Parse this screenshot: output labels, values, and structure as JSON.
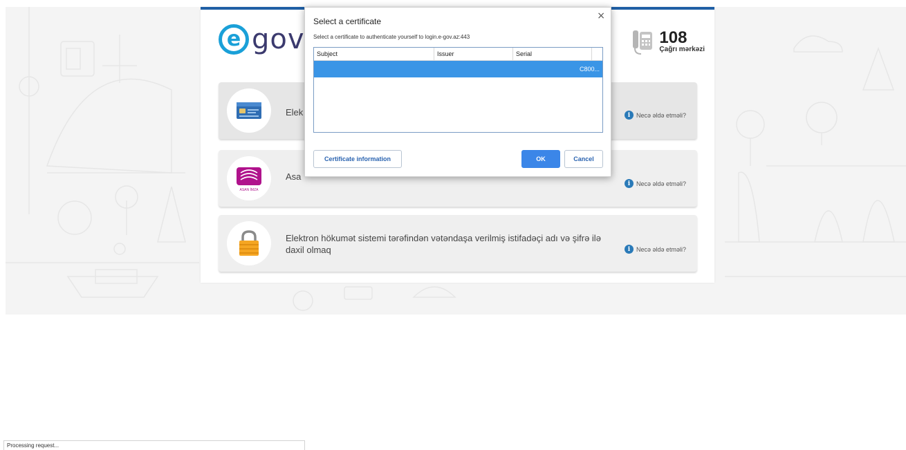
{
  "header": {
    "logo_symbol": "e",
    "logo_text": "gov",
    "call_number": "108",
    "call_label": "Çağrı mərkəzi"
  },
  "options": [
    {
      "text": "Elek",
      "help": "Necə əldə etməli?",
      "icon": "id-card-icon"
    },
    {
      "text": "Asa",
      "help": "Necə əldə etməli?",
      "icon": "asan-imza-icon",
      "icon_caption": "ASAN İMZA"
    },
    {
      "text": "Elektron hökumət sistemi tərəfindən vətəndaşa verilmiş istifadəçi adı və şifrə ilə daxil olmaq",
      "help": "Necə əldə etməli?",
      "icon": "padlock-icon"
    }
  ],
  "dialog": {
    "title": "Select a certificate",
    "subtitle": "Select a certificate to authenticate yourself to login.e-gov.az:443",
    "columns": [
      "Subject",
      "Issuer",
      "Serial"
    ],
    "rows": [
      {
        "subject": "",
        "issuer": "",
        "serial": "C800..."
      }
    ],
    "cert_info_label": "Certificate information",
    "ok_label": "OK",
    "cancel_label": "Cancel",
    "close_glyph": "×"
  },
  "status": {
    "text": "Processing request..."
  },
  "colors": {
    "accent": "#1f5fa5",
    "logo_blue": "#1aa0d8",
    "selection": "#3a95e6",
    "primary_button": "#3b86e8",
    "lock_orange": "#f5a623"
  }
}
